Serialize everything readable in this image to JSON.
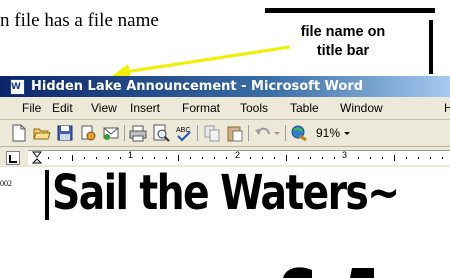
{
  "caption": {
    "text": "n file has a file name"
  },
  "callout": {
    "line1": "file name on",
    "line2": "title bar"
  },
  "window": {
    "title": "Hidden Lake Announcement - Microsoft Word",
    "menu": [
      "File",
      "Edit",
      "View",
      "Insert",
      "Format",
      "Tools",
      "Table",
      "Window",
      "H"
    ],
    "toolbar": {
      "icons": [
        "new-document-icon",
        "open-folder-icon",
        "save-icon",
        "permission-icon",
        "email-icon",
        "print-icon",
        "print-preview-icon",
        "spelling-icon",
        "copy-icon",
        "paste-icon",
        "undo-icon",
        "dropdown-icon",
        "insert-hyperlink-icon"
      ],
      "zoom": "91%"
    },
    "ruler": {
      "numbers": [
        "1",
        "2",
        "3"
      ]
    }
  },
  "document": {
    "heading": "Sail the Waters~",
    "footer_fragment": "002"
  },
  "colors": {
    "titlebar_start": "#0a246a",
    "titlebar_end": "#a6caf0",
    "arrow": "#f0f000",
    "chrome": "#ece9d8"
  }
}
